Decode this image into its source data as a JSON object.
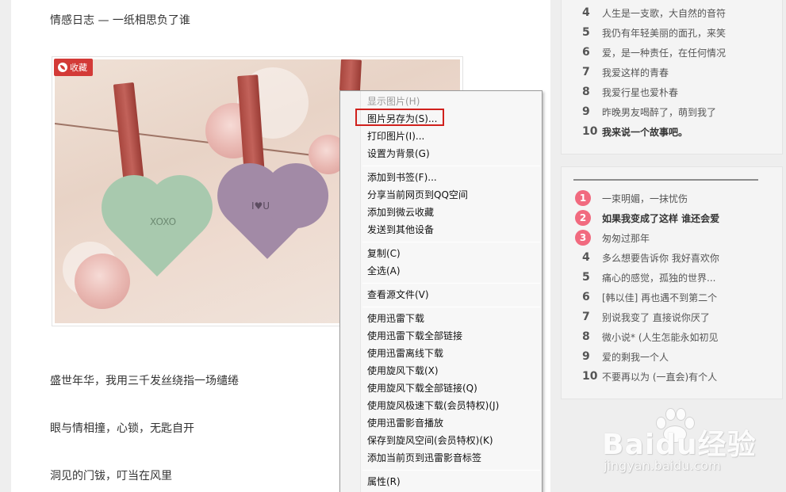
{
  "article": {
    "heading": "情感日志 — 一纸相思负了谁",
    "collect_badge": "收藏",
    "lines": [
      "盛世年华，我用三千发丝绕指一场缱绻",
      "眼与情相撞，心锁，无匙自开",
      "洞见的门钹，叮当在风里"
    ],
    "photo_heart_texts": [
      "XOXO",
      "I♥U"
    ]
  },
  "sidebar_top": {
    "items": [
      {
        "rank": "4",
        "title": "人生是一支歌，大自然的音符"
      },
      {
        "rank": "5",
        "title": "我仍有年轻美丽的面孔，来笑"
      },
      {
        "rank": "6",
        "title": "爱，是一种责任，在任何情况"
      },
      {
        "rank": "7",
        "title": "我爱这样的青春"
      },
      {
        "rank": "8",
        "title": "我爱行星也爱朴春"
      },
      {
        "rank": "9",
        "title": "昨晚男友喝醉了，萌到我了"
      },
      {
        "rank": "10",
        "title": "我来说一个故事吧。"
      }
    ]
  },
  "sidebar_bottom": {
    "items": [
      {
        "rank": "1",
        "title": "一束明媚，一抹忧伤"
      },
      {
        "rank": "2",
        "title": "如果我变成了这样 谁还会爱"
      },
      {
        "rank": "3",
        "title": "匆匆过那年"
      },
      {
        "rank": "4",
        "title": "多么想要告诉你 我好喜欢你"
      },
      {
        "rank": "5",
        "title": "痛心的感觉，孤独的世界..."
      },
      {
        "rank": "6",
        "title": "[韩以佳] 再也遇不到第二个"
      },
      {
        "rank": "7",
        "title": "别说我变了 直接说你厌了"
      },
      {
        "rank": "8",
        "title": "微小说* (人生怎能永如初见"
      },
      {
        "rank": "9",
        "title": "爱的剩我一个人"
      },
      {
        "rank": "10",
        "title": "不要再以为 (一直会)有个人"
      }
    ]
  },
  "context_menu": {
    "items": [
      {
        "label": "显示图片(H)",
        "disabled": true
      },
      {
        "label": "图片另存为(S)...",
        "highlighted": true
      },
      {
        "label": "打印图片(I)..."
      },
      {
        "label": "设置为背景(G)"
      },
      {
        "label": "添加到书签(F)..."
      },
      {
        "label": "分享当前网页到QQ空间"
      },
      {
        "label": "添加到微云收藏"
      },
      {
        "label": "发送到其他设备"
      },
      {
        "label": "复制(C)"
      },
      {
        "label": "全选(A)"
      },
      {
        "label": "查看源文件(V)"
      },
      {
        "label": "使用迅雷下载"
      },
      {
        "label": "使用迅雷下载全部链接"
      },
      {
        "label": "使用迅雷离线下载"
      },
      {
        "label": "使用旋风下载(X)"
      },
      {
        "label": "使用旋风下载全部链接(Q)"
      },
      {
        "label": "使用旋风极速下载(会员特权)(J)"
      },
      {
        "label": "使用迅雷影音播放"
      },
      {
        "label": "保存到旋风空间(会员特权)(K)"
      },
      {
        "label": "添加当前页到迅雷影音标签"
      },
      {
        "label": "属性(R)"
      }
    ]
  },
  "watermark": {
    "brand": "Baidu经验",
    "url": "jingyan.baidu.com"
  },
  "colors": {
    "accent_red": "#d33a37",
    "hot_rank": "#f16a7f",
    "highlight_border": "#d0201c"
  }
}
